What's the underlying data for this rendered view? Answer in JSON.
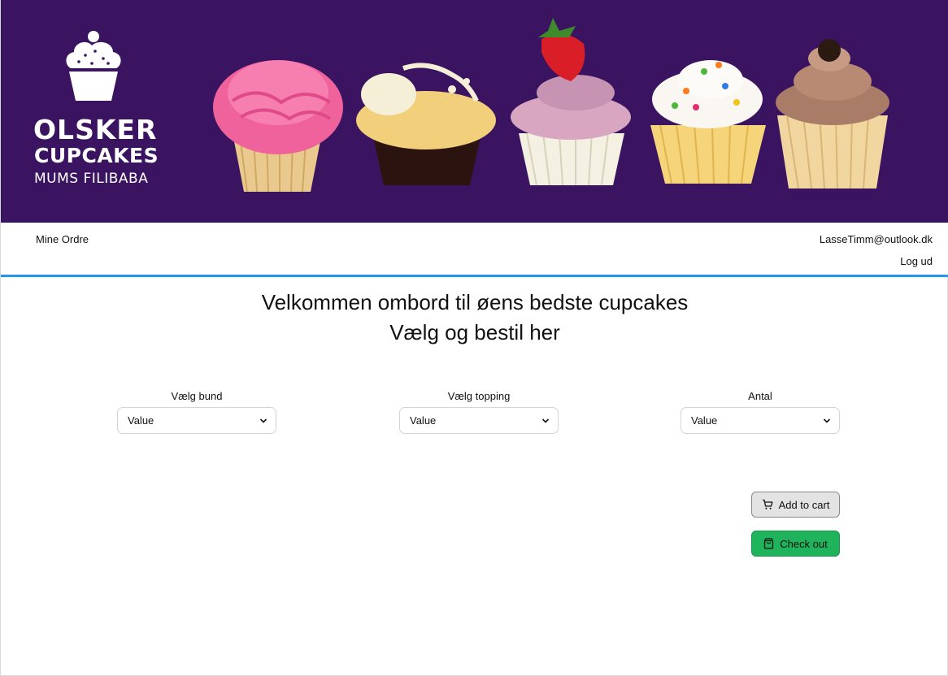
{
  "brand": {
    "line1": "OLSKER",
    "line2": "CUPCAKES",
    "line3": "MUMS FILIBABA"
  },
  "colors": {
    "banner": "#3b1461",
    "nav_border": "#2196f3",
    "checkout": "#1fb35b"
  },
  "nav": {
    "orders_label": "Mine Ordre",
    "user_email": "LasseTimm@outlook.dk",
    "logout_label": "Log ud"
  },
  "main": {
    "heading_line1": "Velkommen ombord til øens bedste cupcakes",
    "heading_line2": "Vælg og bestil her"
  },
  "form": {
    "fields": [
      {
        "label": "Vælg bund",
        "value": "Value"
      },
      {
        "label": "Vælg topping",
        "value": "Value"
      },
      {
        "label": "Antal",
        "value": "Value"
      }
    ]
  },
  "actions": {
    "add_to_cart": "Add to cart",
    "checkout": "Check out",
    "cart_icon": "cart-icon",
    "checkout_icon": "shopping-bag-icon"
  }
}
